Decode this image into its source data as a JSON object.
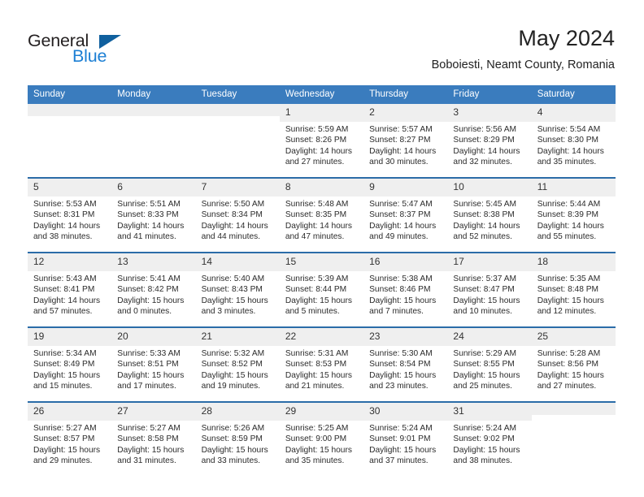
{
  "brand": {
    "name_top": "General",
    "name_bottom": "Blue",
    "flag_icon": "blue-triangle-flag",
    "accent_color": "#1c7fd4",
    "flag_color": "#10609e"
  },
  "header": {
    "month_title": "May 2024",
    "location": "Boboiesti, Neamt County, Romania"
  },
  "calendar": {
    "header_bg": "#3a7cbe",
    "row_separator_color": "#2b6ca8",
    "daynum_bg": "#efefef",
    "weekday_headers": [
      "Sunday",
      "Monday",
      "Tuesday",
      "Wednesday",
      "Thursday",
      "Friday",
      "Saturday"
    ],
    "weeks": [
      [
        {
          "day": "",
          "blank": true
        },
        {
          "day": "",
          "blank": true
        },
        {
          "day": "",
          "blank": true
        },
        {
          "day": "1",
          "sunrise": "Sunrise: 5:59 AM",
          "sunset": "Sunset: 8:26 PM",
          "daylight_line1": "Daylight: 14 hours",
          "daylight_line2": "and 27 minutes."
        },
        {
          "day": "2",
          "sunrise": "Sunrise: 5:57 AM",
          "sunset": "Sunset: 8:27 PM",
          "daylight_line1": "Daylight: 14 hours",
          "daylight_line2": "and 30 minutes."
        },
        {
          "day": "3",
          "sunrise": "Sunrise: 5:56 AM",
          "sunset": "Sunset: 8:29 PM",
          "daylight_line1": "Daylight: 14 hours",
          "daylight_line2": "and 32 minutes."
        },
        {
          "day": "4",
          "sunrise": "Sunrise: 5:54 AM",
          "sunset": "Sunset: 8:30 PM",
          "daylight_line1": "Daylight: 14 hours",
          "daylight_line2": "and 35 minutes."
        }
      ],
      [
        {
          "day": "5",
          "sunrise": "Sunrise: 5:53 AM",
          "sunset": "Sunset: 8:31 PM",
          "daylight_line1": "Daylight: 14 hours",
          "daylight_line2": "and 38 minutes."
        },
        {
          "day": "6",
          "sunrise": "Sunrise: 5:51 AM",
          "sunset": "Sunset: 8:33 PM",
          "daylight_line1": "Daylight: 14 hours",
          "daylight_line2": "and 41 minutes."
        },
        {
          "day": "7",
          "sunrise": "Sunrise: 5:50 AM",
          "sunset": "Sunset: 8:34 PM",
          "daylight_line1": "Daylight: 14 hours",
          "daylight_line2": "and 44 minutes."
        },
        {
          "day": "8",
          "sunrise": "Sunrise: 5:48 AM",
          "sunset": "Sunset: 8:35 PM",
          "daylight_line1": "Daylight: 14 hours",
          "daylight_line2": "and 47 minutes."
        },
        {
          "day": "9",
          "sunrise": "Sunrise: 5:47 AM",
          "sunset": "Sunset: 8:37 PM",
          "daylight_line1": "Daylight: 14 hours",
          "daylight_line2": "and 49 minutes."
        },
        {
          "day": "10",
          "sunrise": "Sunrise: 5:45 AM",
          "sunset": "Sunset: 8:38 PM",
          "daylight_line1": "Daylight: 14 hours",
          "daylight_line2": "and 52 minutes."
        },
        {
          "day": "11",
          "sunrise": "Sunrise: 5:44 AM",
          "sunset": "Sunset: 8:39 PM",
          "daylight_line1": "Daylight: 14 hours",
          "daylight_line2": "and 55 minutes."
        }
      ],
      [
        {
          "day": "12",
          "sunrise": "Sunrise: 5:43 AM",
          "sunset": "Sunset: 8:41 PM",
          "daylight_line1": "Daylight: 14 hours",
          "daylight_line2": "and 57 minutes."
        },
        {
          "day": "13",
          "sunrise": "Sunrise: 5:41 AM",
          "sunset": "Sunset: 8:42 PM",
          "daylight_line1": "Daylight: 15 hours",
          "daylight_line2": "and 0 minutes."
        },
        {
          "day": "14",
          "sunrise": "Sunrise: 5:40 AM",
          "sunset": "Sunset: 8:43 PM",
          "daylight_line1": "Daylight: 15 hours",
          "daylight_line2": "and 3 minutes."
        },
        {
          "day": "15",
          "sunrise": "Sunrise: 5:39 AM",
          "sunset": "Sunset: 8:44 PM",
          "daylight_line1": "Daylight: 15 hours",
          "daylight_line2": "and 5 minutes."
        },
        {
          "day": "16",
          "sunrise": "Sunrise: 5:38 AM",
          "sunset": "Sunset: 8:46 PM",
          "daylight_line1": "Daylight: 15 hours",
          "daylight_line2": "and 7 minutes."
        },
        {
          "day": "17",
          "sunrise": "Sunrise: 5:37 AM",
          "sunset": "Sunset: 8:47 PM",
          "daylight_line1": "Daylight: 15 hours",
          "daylight_line2": "and 10 minutes."
        },
        {
          "day": "18",
          "sunrise": "Sunrise: 5:35 AM",
          "sunset": "Sunset: 8:48 PM",
          "daylight_line1": "Daylight: 15 hours",
          "daylight_line2": "and 12 minutes."
        }
      ],
      [
        {
          "day": "19",
          "sunrise": "Sunrise: 5:34 AM",
          "sunset": "Sunset: 8:49 PM",
          "daylight_line1": "Daylight: 15 hours",
          "daylight_line2": "and 15 minutes."
        },
        {
          "day": "20",
          "sunrise": "Sunrise: 5:33 AM",
          "sunset": "Sunset: 8:51 PM",
          "daylight_line1": "Daylight: 15 hours",
          "daylight_line2": "and 17 minutes."
        },
        {
          "day": "21",
          "sunrise": "Sunrise: 5:32 AM",
          "sunset": "Sunset: 8:52 PM",
          "daylight_line1": "Daylight: 15 hours",
          "daylight_line2": "and 19 minutes."
        },
        {
          "day": "22",
          "sunrise": "Sunrise: 5:31 AM",
          "sunset": "Sunset: 8:53 PM",
          "daylight_line1": "Daylight: 15 hours",
          "daylight_line2": "and 21 minutes."
        },
        {
          "day": "23",
          "sunrise": "Sunrise: 5:30 AM",
          "sunset": "Sunset: 8:54 PM",
          "daylight_line1": "Daylight: 15 hours",
          "daylight_line2": "and 23 minutes."
        },
        {
          "day": "24",
          "sunrise": "Sunrise: 5:29 AM",
          "sunset": "Sunset: 8:55 PM",
          "daylight_line1": "Daylight: 15 hours",
          "daylight_line2": "and 25 minutes."
        },
        {
          "day": "25",
          "sunrise": "Sunrise: 5:28 AM",
          "sunset": "Sunset: 8:56 PM",
          "daylight_line1": "Daylight: 15 hours",
          "daylight_line2": "and 27 minutes."
        }
      ],
      [
        {
          "day": "26",
          "sunrise": "Sunrise: 5:27 AM",
          "sunset": "Sunset: 8:57 PM",
          "daylight_line1": "Daylight: 15 hours",
          "daylight_line2": "and 29 minutes."
        },
        {
          "day": "27",
          "sunrise": "Sunrise: 5:27 AM",
          "sunset": "Sunset: 8:58 PM",
          "daylight_line1": "Daylight: 15 hours",
          "daylight_line2": "and 31 minutes."
        },
        {
          "day": "28",
          "sunrise": "Sunrise: 5:26 AM",
          "sunset": "Sunset: 8:59 PM",
          "daylight_line1": "Daylight: 15 hours",
          "daylight_line2": "and 33 minutes."
        },
        {
          "day": "29",
          "sunrise": "Sunrise: 5:25 AM",
          "sunset": "Sunset: 9:00 PM",
          "daylight_line1": "Daylight: 15 hours",
          "daylight_line2": "and 35 minutes."
        },
        {
          "day": "30",
          "sunrise": "Sunrise: 5:24 AM",
          "sunset": "Sunset: 9:01 PM",
          "daylight_line1": "Daylight: 15 hours",
          "daylight_line2": "and 37 minutes."
        },
        {
          "day": "31",
          "sunrise": "Sunrise: 5:24 AM",
          "sunset": "Sunset: 9:02 PM",
          "daylight_line1": "Daylight: 15 hours",
          "daylight_line2": "and 38 minutes."
        },
        {
          "day": "",
          "blank": true
        }
      ]
    ]
  }
}
